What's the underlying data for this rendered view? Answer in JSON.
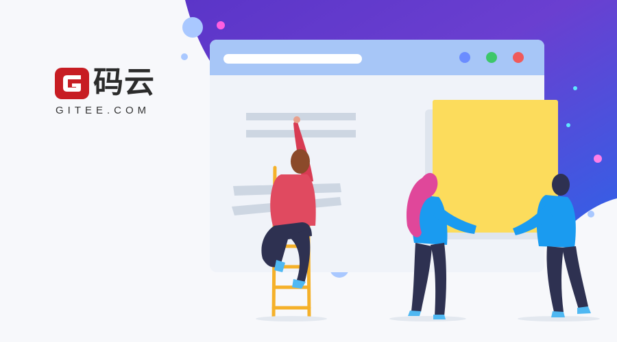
{
  "brand": {
    "name_cn": "码云",
    "domain": "GITEE.COM",
    "logo_icon": "gitee-g-logo-icon",
    "brand_color": "#c71d23"
  },
  "illustration": {
    "browser_window_dots": [
      "#6b8cff",
      "#3dc76a",
      "#f05a5a"
    ],
    "note_color": "#fcdc5c",
    "gradient_colors": [
      "#5b35c8",
      "#7b3fc4",
      "#2f6fe8"
    ]
  }
}
